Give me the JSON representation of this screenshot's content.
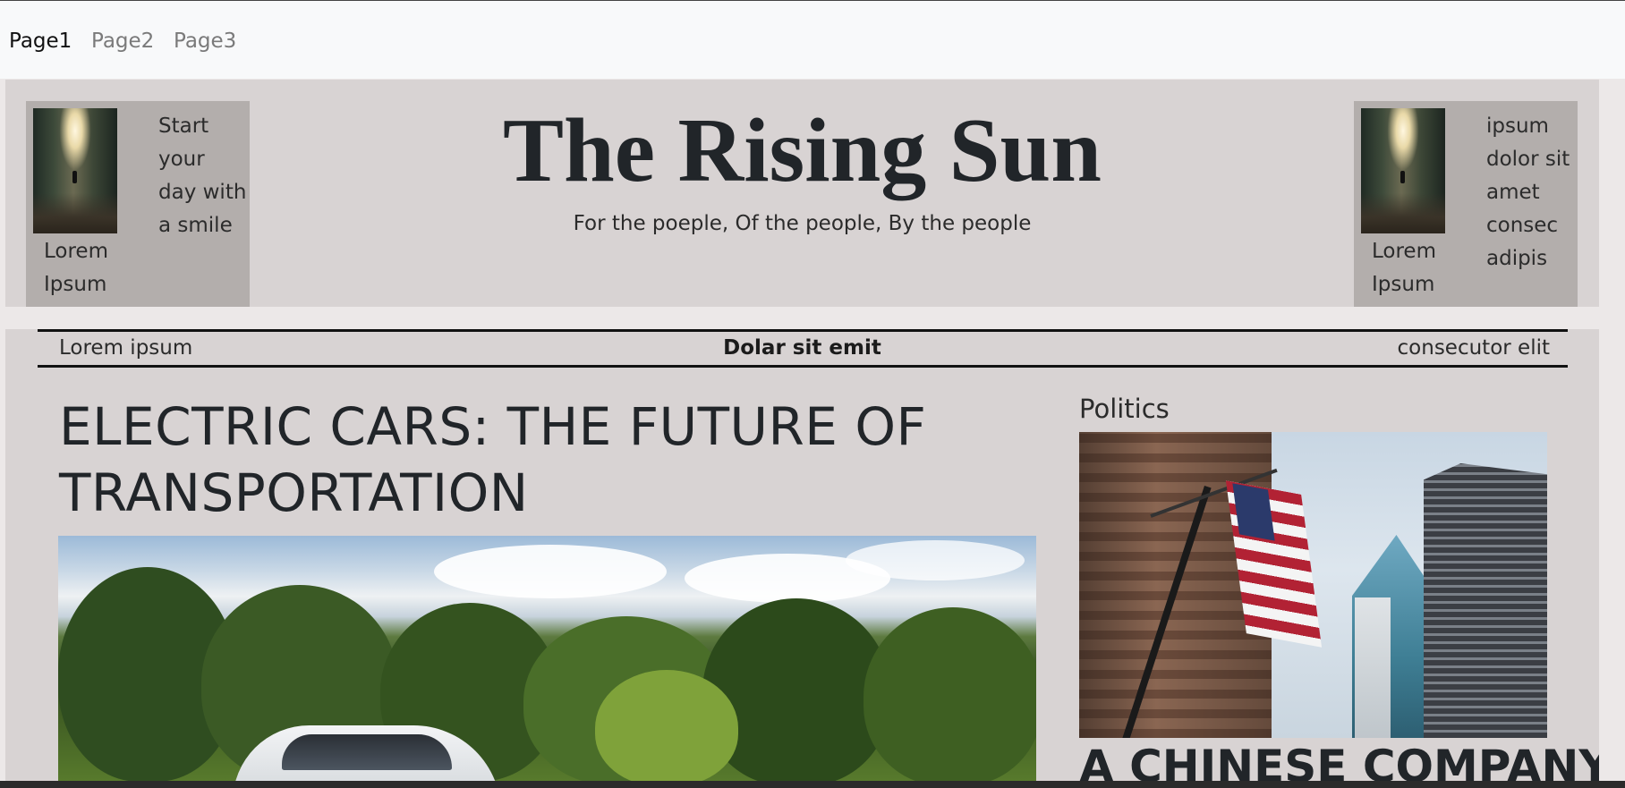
{
  "nav": {
    "items": [
      {
        "label": "Page1",
        "active": true
      },
      {
        "label": "Page2",
        "active": false
      },
      {
        "label": "Page3",
        "active": false
      }
    ]
  },
  "masthead": {
    "title": "The Rising Sun",
    "tagline": "For the poeple, Of the people, By the people",
    "left_ear": {
      "text_lines": [
        "Start",
        "your",
        "day with",
        "a smile"
      ],
      "caption_lines": [
        "Lorem",
        "Ipsum"
      ]
    },
    "right_ear": {
      "text_lines": [
        "ipsum",
        "dolor sit",
        "amet",
        "consec",
        "adipis"
      ],
      "caption_lines": [
        "Lorem",
        "Ipsum"
      ]
    }
  },
  "ticker": {
    "left": "Lorem ipsum",
    "center": "Dolar sit emit",
    "right": "consecutor elit"
  },
  "lead_story": {
    "headline_line1": "ELECTRIC CARS: THE FUTURE OF",
    "headline_line2": "TRANSPORTATION"
  },
  "sidebar": {
    "section": "Politics",
    "headline": "A CHINESE COMPANY"
  },
  "colors": {
    "navbar_bg": "#f8f9fa",
    "band_bg": "#d8d3d3",
    "ear_bg": "#b3aeac",
    "text": "#212529"
  }
}
